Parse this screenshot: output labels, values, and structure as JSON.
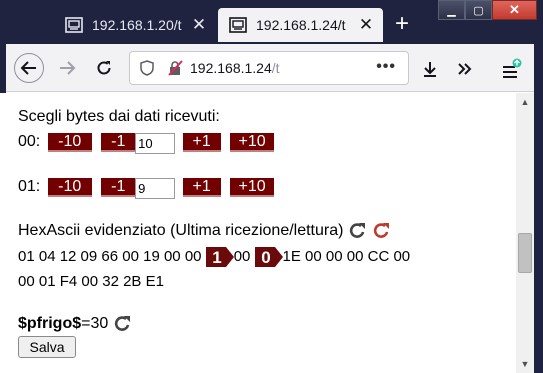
{
  "browser": {
    "tabs": [
      {
        "title": "192.168.1.20/t",
        "active": false,
        "icon": "terminal-icon"
      },
      {
        "title": "192.168.1.24/t",
        "active": true,
        "icon": "terminal-icon"
      }
    ],
    "newtab_label": "+",
    "address": {
      "host": "192.168.1.24",
      "path": "/t"
    }
  },
  "page": {
    "select_heading": "Scegli bytes dai dati ricevuti:",
    "rows": [
      {
        "label": "00:",
        "minus10": "-10",
        "minus1": "-1",
        "value": "10",
        "plus1": "+1",
        "plus10": "+10"
      },
      {
        "label": "01:",
        "minus10": "-10",
        "minus1": "-1",
        "value": "9",
        "plus1": "+1",
        "plus10": "+10"
      }
    ],
    "hex_heading": "HexAscii evidenziato (Ultima ricezione/lettura)",
    "hex_line1_before": "01 04 12 09 66 00 19 00 00",
    "marker1": "1",
    "hex_line1_mid": "00",
    "marker0": "0",
    "hex_line1_after": "1E 00 00 00 CC 00",
    "hex_line2": "00 01 F4 00 32 2B E1",
    "var_name": "$pfrigo$",
    "var_value": "=30",
    "save_label": "Salva"
  },
  "colors": {
    "button_bg": "#730000",
    "marker_bg": "#6b0a0a",
    "reload_red": "#c0392b",
    "titlebar": "#202340"
  }
}
